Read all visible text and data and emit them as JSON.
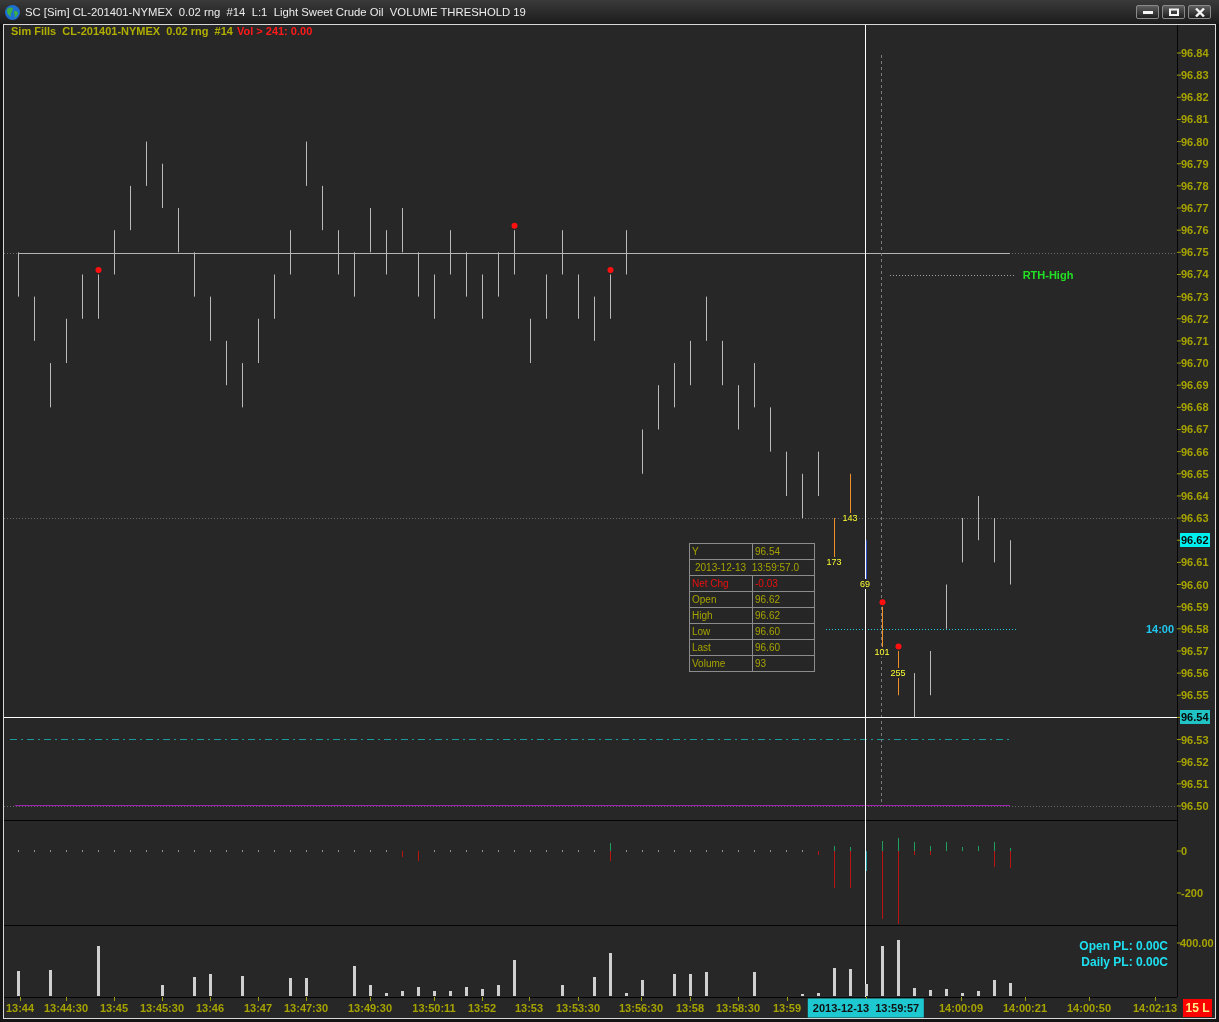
{
  "window": {
    "title": "SC [Sim] CL-201401-NYMEX  0.02 rng  #14  L:1  Light Sweet Crude Oil  VOLUME THRESHOLD 19"
  },
  "chart": {
    "header": [
      {
        "text": "Sim Fills  CL-201401-NYMEX  0.02 rng  #14",
        "color": "#b0ae00"
      },
      {
        "text": "Vol > 241: 0.00",
        "color": "#ff1a1a"
      }
    ],
    "price_axis": [
      {
        "text": "96.84",
        "kind": "tick"
      },
      {
        "text": "96.83",
        "kind": "tick"
      },
      {
        "text": "96.82",
        "kind": "tick"
      },
      {
        "text": "96.81",
        "kind": "tick"
      },
      {
        "text": "96.80",
        "kind": "tick"
      },
      {
        "text": "96.79",
        "kind": "tick"
      },
      {
        "text": "96.78",
        "kind": "tick"
      },
      {
        "text": "96.77",
        "kind": "tick"
      },
      {
        "text": "96.76",
        "kind": "tick"
      },
      {
        "text": "96.75",
        "kind": "tick"
      },
      {
        "text": "96.74",
        "kind": "tick"
      },
      {
        "text": "96.73",
        "kind": "tick"
      },
      {
        "text": "96.72",
        "kind": "tick"
      },
      {
        "text": "96.71",
        "kind": "tick"
      },
      {
        "text": "96.70",
        "kind": "tick"
      },
      {
        "text": "96.69",
        "kind": "tick"
      },
      {
        "text": "96.68",
        "kind": "tick"
      },
      {
        "text": "96.67",
        "kind": "tick"
      },
      {
        "text": "96.66",
        "kind": "tick"
      },
      {
        "text": "96.65",
        "kind": "tick"
      },
      {
        "text": "96.64",
        "kind": "tick"
      },
      {
        "text": "96.63",
        "kind": "tick"
      },
      {
        "text": "96.62",
        "kind": "marker",
        "color": "#00f0f0"
      },
      {
        "text": "96.61",
        "kind": "tick"
      },
      {
        "text": "96.60",
        "kind": "tick"
      },
      {
        "text": "96.59",
        "kind": "tick"
      },
      {
        "text": "96.58",
        "kind": "tick"
      },
      {
        "text": "96.57",
        "kind": "tick"
      },
      {
        "text": "96.56",
        "kind": "tick"
      },
      {
        "text": "96.55",
        "kind": "tick"
      },
      {
        "text": "96.54",
        "kind": "marker",
        "color": "#20c4c4"
      },
      {
        "text": "96.53",
        "kind": "tick"
      },
      {
        "text": "96.52",
        "kind": "tick"
      },
      {
        "text": "96.51",
        "kind": "tick"
      },
      {
        "text": "96.50",
        "kind": "tick"
      }
    ],
    "bar_labels": [
      "173",
      "143",
      "69",
      "101",
      "255"
    ],
    "level_labels": [
      {
        "text": "RTH-High",
        "color": "#22e022"
      },
      {
        "text": "14:00",
        "color": "#20c8f0"
      }
    ],
    "data_window": [
      {
        "kind": "pair",
        "label": "Y",
        "value": "96.54"
      },
      {
        "kind": "wide",
        "text": "2013-12-13  13:59:57.0"
      },
      {
        "kind": "change",
        "label": "Net Chg",
        "value": "-0.03"
      },
      {
        "kind": "pair",
        "label": "Open",
        "value": "96.62"
      },
      {
        "kind": "pair",
        "label": "High",
        "value": "96.62"
      },
      {
        "kind": "pair",
        "label": "Low",
        "value": "96.60"
      },
      {
        "kind": "pair",
        "label": "Last",
        "value": "96.60"
      },
      {
        "kind": "pair",
        "label": "Volume",
        "value": "93"
      }
    ],
    "delta_axis": [
      "0",
      "-200"
    ],
    "volume_axis": [
      "400.00"
    ],
    "pl_lines": [
      "Open PL: 0.00C",
      "Daily PL: 0.00C"
    ],
    "time_axis": [
      {
        "text": "13:44",
        "kind": "tick"
      },
      {
        "text": "13:44:30",
        "kind": "tick"
      },
      {
        "text": "13:45",
        "kind": "tick"
      },
      {
        "text": "13:45:30",
        "kind": "tick"
      },
      {
        "text": "13:46",
        "kind": "tick"
      },
      {
        "text": "13:47",
        "kind": "tick"
      },
      {
        "text": "13:47:30",
        "kind": "tick"
      },
      {
        "text": "13:49:30",
        "kind": "tick"
      },
      {
        "text": "13:50:11",
        "kind": "tick"
      },
      {
        "text": "13:52",
        "kind": "tick"
      },
      {
        "text": "13:53",
        "kind": "tick"
      },
      {
        "text": "13:53:30",
        "kind": "tick"
      },
      {
        "text": "13:56:30",
        "kind": "tick"
      },
      {
        "text": "13:58",
        "kind": "tick"
      },
      {
        "text": "13:58:30",
        "kind": "tick"
      },
      {
        "text": "13:59",
        "kind": "tick"
      },
      {
        "text": "2013-12-13  13:59:57",
        "kind": "cursor"
      },
      {
        "text": "14:00:09",
        "kind": "tick"
      },
      {
        "text": "14:00:21",
        "kind": "tick"
      },
      {
        "text": "14:00:50",
        "kind": "tick"
      },
      {
        "text": "14:02:13",
        "kind": "tick"
      }
    ],
    "position_badge": "15 L"
  }
}
